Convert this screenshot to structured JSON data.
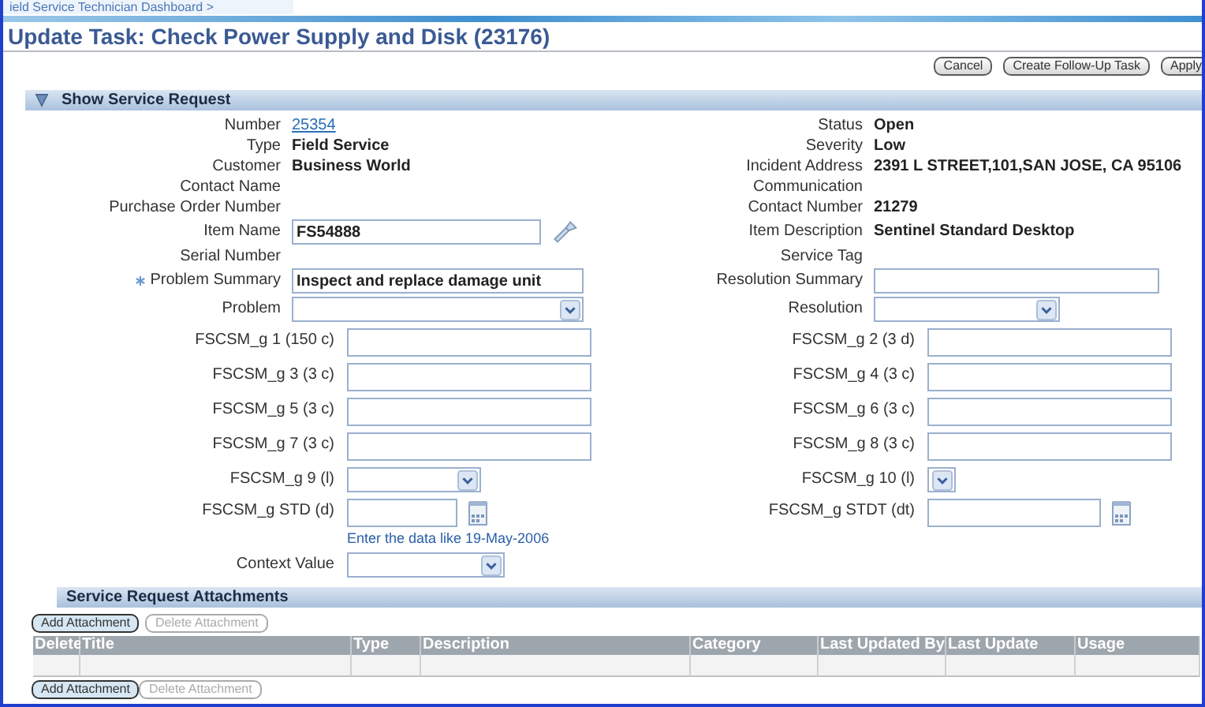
{
  "breadcrumb": "ield Service Technician Dashboard >",
  "title": "Update Task: Check Power Supply and Disk (23176)",
  "actions": [
    {
      "label": "Cancel"
    },
    {
      "label": "Create Follow-Up Task"
    },
    {
      "label": "Apply"
    }
  ],
  "service_request": {
    "heading": "Show Service Request",
    "expanded": true,
    "left_fields": [
      {
        "label": "Number",
        "kind": "link",
        "value": "25354",
        "required": false
      },
      {
        "label": "Type",
        "kind": "text",
        "value": "Field Service",
        "required": false
      },
      {
        "label": "Customer",
        "kind": "text",
        "value": "Business World",
        "required": false
      },
      {
        "label": "Contact Name",
        "kind": "text",
        "required": false
      },
      {
        "label": "Purchase Order Number",
        "kind": "text",
        "required": false
      },
      {
        "label": "Item Name",
        "kind": "lookup",
        "value": "FS54888",
        "required": false
      },
      {
        "label": "Serial Number",
        "kind": "text",
        "required": false
      },
      {
        "label": "Problem Summary",
        "kind": "input",
        "value": "Inspect and replace damage unit",
        "required": true
      },
      {
        "label": "Problem",
        "kind": "select",
        "required": false
      }
    ],
    "right_fields": [
      {
        "label": "Status",
        "kind": "text",
        "value": "Open",
        "required": false
      },
      {
        "label": "Severity",
        "kind": "text",
        "value": "Low",
        "required": false
      },
      {
        "label": "Incident Address",
        "kind": "text",
        "value": "2391 L STREET,101,SAN JOSE, CA 95106",
        "required": false
      },
      {
        "label": "Communication",
        "kind": "text",
        "required": false
      },
      {
        "label": "Contact Number",
        "kind": "text",
        "value": "21279",
        "required": false
      },
      {
        "label": "Item Description",
        "kind": "text",
        "value": "Sentinel Standard Desktop",
        "required": false
      },
      {
        "label": "Service Tag",
        "kind": "text",
        "required": false
      },
      {
        "label": "Resolution Summary",
        "kind": "input",
        "required": false
      },
      {
        "label": "Resolution",
        "kind": "select",
        "required": false
      }
    ],
    "flex_left": [
      {
        "label": "FSCSM_g 1 (150 c)",
        "kind": "input"
      },
      {
        "label": "FSCSM_g 3 (3 c)",
        "kind": "input"
      },
      {
        "label": "FSCSM_g 5 (3 c)",
        "kind": "input"
      },
      {
        "label": "FSCSM_g 7 (3 c)",
        "kind": "input"
      },
      {
        "label": "FSCSM_g 9 (l)",
        "kind": "select"
      },
      {
        "label": "FSCSM_g STD (d)",
        "kind": "date",
        "hint": "Enter the data like 19-May-2006"
      },
      {
        "label": "Context Value",
        "kind": "select"
      }
    ],
    "flex_right": [
      {
        "label": "FSCSM_g 2 (3 d)",
        "kind": "input"
      },
      {
        "label": "FSCSM_g 4 (3 c)",
        "kind": "input"
      },
      {
        "label": "FSCSM_g 6 (3 c)",
        "kind": "input"
      },
      {
        "label": "FSCSM_g 8 (3 c)",
        "kind": "input"
      },
      {
        "label": "FSCSM_g 10 (l)",
        "kind": "select"
      },
      {
        "label": "FSCSM_g STDT (dt)",
        "kind": "date"
      }
    ]
  },
  "attachments": {
    "heading": "Service Request Attachments",
    "buttons": [
      {
        "label": "Add Attachment",
        "disabled": false
      },
      {
        "label": "Delete Attachment",
        "disabled": true
      }
    ],
    "columns": [
      "Delete",
      "Title",
      "Type",
      "Description",
      "Category",
      "Last Updated By",
      "Last Update",
      "Usage"
    ],
    "bottom_buttons": [
      {
        "label": "Add Attachment",
        "disabled": false
      },
      {
        "label": "Delete Attachment",
        "disabled": true
      }
    ]
  }
}
